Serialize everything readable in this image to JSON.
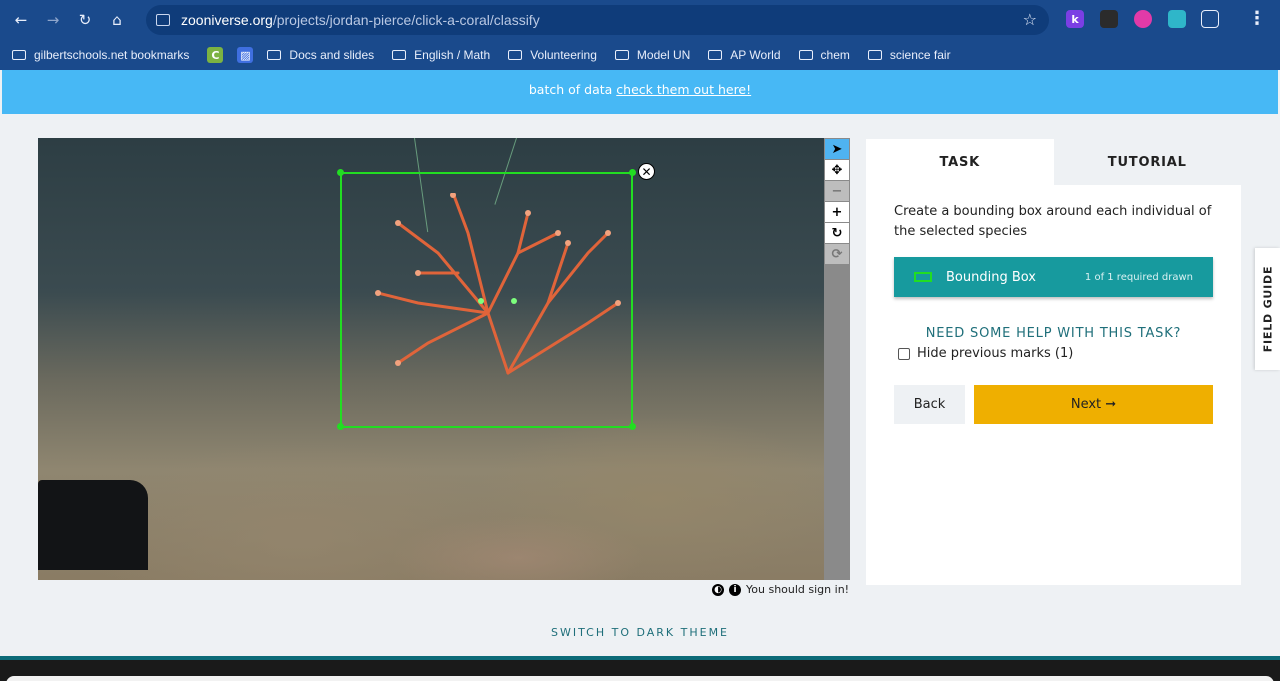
{
  "browser": {
    "url_host": "zooniverse.org",
    "url_path": "/projects/jordan-pierce/click-a-coral/classify",
    "extensions": [
      {
        "name": "k-extension-icon",
        "letter": "k",
        "color": "#7b3fe4"
      },
      {
        "name": "dog-extension-icon",
        "letter": "",
        "color": "#2b2b2b"
      },
      {
        "name": "pink-extension-icon",
        "letter": "",
        "color": "#e23aa8"
      },
      {
        "name": "teal-extension-icon",
        "letter": "",
        "color": "#2fb6c9"
      }
    ]
  },
  "bookmarks": [
    {
      "label": "gilbertschools.net bookmarks"
    },
    {
      "label": "Docs and slides"
    },
    {
      "label": "English / Math"
    },
    {
      "label": "Volunteering"
    },
    {
      "label": "Model UN"
    },
    {
      "label": "AP World"
    },
    {
      "label": "chem"
    },
    {
      "label": "science fair"
    }
  ],
  "banner": {
    "text": "batch of data",
    "link": "check them out here!"
  },
  "signin_text": "You should sign in!",
  "task_panel": {
    "tabs": [
      "TASK",
      "TUTORIAL"
    ],
    "instruction": "Create a bounding box around each individual of the selected species",
    "tool_label": "Bounding Box",
    "tool_count": "1 of 1 required drawn",
    "help_link": "NEED SOME HELP WITH THIS TASK?",
    "hide_marks": "Hide previous marks (1)",
    "back": "Back",
    "next": "Next ➞"
  },
  "field_guide": "FIELD GUIDE",
  "dark_theme": "SWITCH TO DARK THEME",
  "colors": {
    "banner": "#47b8f5",
    "tool_teal": "#179a9e",
    "next_button": "#efaf00",
    "bbox_green": "#22dd22"
  }
}
